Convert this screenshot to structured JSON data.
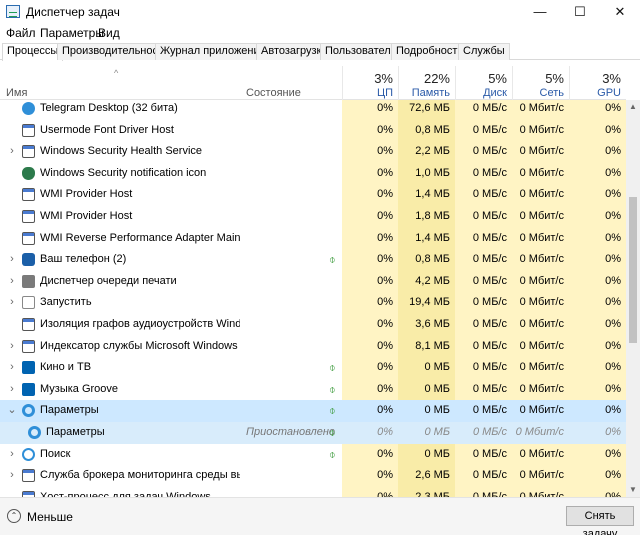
{
  "window": {
    "title": "Диспетчер задач",
    "minimize": "—",
    "maximize": "☐",
    "close": "✕"
  },
  "menu": [
    "Файл",
    "Параметры",
    "Вид"
  ],
  "tabs": [
    "Процессы",
    "Производительность",
    "Журнал приложений",
    "Автозагрузка",
    "Пользователи",
    "Подробности",
    "Службы"
  ],
  "header": {
    "sort_indicator": "^",
    "name": "Имя",
    "status": "Состояние",
    "cpu": {
      "pct": "3%",
      "label": "ЦП"
    },
    "mem": {
      "pct": "22%",
      "label": "Память"
    },
    "disk": {
      "pct": "5%",
      "label": "Диск"
    },
    "net": {
      "pct": "5%",
      "label": "Сеть"
    },
    "gpu": {
      "pct": "3%",
      "label": "GPU"
    }
  },
  "rows": [
    {
      "name": "Telegram Desktop (32 бита)",
      "status": "",
      "cpu": "0%",
      "mem": "72,6 МБ",
      "disk": "0 МБ/с",
      "net": "0 Мбит/с",
      "gpu": "0%",
      "icon": "telegram-icon",
      "expander": "",
      "leaf": ""
    },
    {
      "name": "Usermode Font Driver Host",
      "status": "",
      "cpu": "0%",
      "mem": "0,8 МБ",
      "disk": "0 МБ/с",
      "net": "0 Мбит/с",
      "gpu": "0%",
      "icon": "window-icon",
      "expander": "",
      "leaf": ""
    },
    {
      "name": "Windows Security Health Service",
      "status": "",
      "cpu": "0%",
      "mem": "2,2 МБ",
      "disk": "0 МБ/с",
      "net": "0 Мбит/с",
      "gpu": "0%",
      "icon": "window-icon",
      "expander": "›",
      "leaf": ""
    },
    {
      "name": "Windows Security notification icon",
      "status": "",
      "cpu": "0%",
      "mem": "1,0 МБ",
      "disk": "0 МБ/с",
      "net": "0 Мбит/с",
      "gpu": "0%",
      "icon": "shield-icon",
      "expander": "",
      "leaf": ""
    },
    {
      "name": "WMI Provider Host",
      "status": "",
      "cpu": "0%",
      "mem": "1,4 МБ",
      "disk": "0 МБ/с",
      "net": "0 Мбит/с",
      "gpu": "0%",
      "icon": "window-icon",
      "expander": "",
      "leaf": ""
    },
    {
      "name": "WMI Provider Host",
      "status": "",
      "cpu": "0%",
      "mem": "1,8 МБ",
      "disk": "0 МБ/с",
      "net": "0 Мбит/с",
      "gpu": "0%",
      "icon": "window-icon",
      "expander": "",
      "leaf": ""
    },
    {
      "name": "WMI Reverse Performance Adapter Maintenan...",
      "status": "",
      "cpu": "0%",
      "mem": "1,4 МБ",
      "disk": "0 МБ/с",
      "net": "0 Мбит/с",
      "gpu": "0%",
      "icon": "window-icon",
      "expander": "",
      "leaf": ""
    },
    {
      "name": "Ваш телефон (2)",
      "status": "",
      "cpu": "0%",
      "mem": "0,8 МБ",
      "disk": "0 МБ/с",
      "net": "0 Мбит/с",
      "gpu": "0%",
      "icon": "phone-icon",
      "expander": "›",
      "leaf": "⌽"
    },
    {
      "name": "Диспетчер очереди печати",
      "status": "",
      "cpu": "0%",
      "mem": "4,2 МБ",
      "disk": "0 МБ/с",
      "net": "0 Мбит/с",
      "gpu": "0%",
      "icon": "printer-icon",
      "expander": "›",
      "leaf": ""
    },
    {
      "name": "Запустить",
      "status": "",
      "cpu": "0%",
      "mem": "19,4 МБ",
      "disk": "0 МБ/с",
      "net": "0 Мбит/с",
      "gpu": "0%",
      "icon": "run-icon",
      "expander": "›",
      "leaf": ""
    },
    {
      "name": "Изоляция графов аудиоустройств Windows",
      "status": "",
      "cpu": "0%",
      "mem": "3,6 МБ",
      "disk": "0 МБ/с",
      "net": "0 Мбит/с",
      "gpu": "0%",
      "icon": "window-icon",
      "expander": "",
      "leaf": ""
    },
    {
      "name": "Индексатор службы Microsoft Windows Sear...",
      "status": "",
      "cpu": "0%",
      "mem": "8,1 МБ",
      "disk": "0 МБ/с",
      "net": "0 Мбит/с",
      "gpu": "0%",
      "icon": "search-indexer-icon",
      "expander": "›",
      "leaf": ""
    },
    {
      "name": "Кино и ТВ",
      "status": "",
      "cpu": "0%",
      "mem": "0 МБ",
      "disk": "0 МБ/с",
      "net": "0 Мбит/с",
      "gpu": "0%",
      "icon": "play-icon",
      "expander": "›",
      "leaf": "⌽"
    },
    {
      "name": "Музыка Groove",
      "status": "",
      "cpu": "0%",
      "mem": "0 МБ",
      "disk": "0 МБ/с",
      "net": "0 Мбит/с",
      "gpu": "0%",
      "icon": "groove-icon",
      "expander": "›",
      "leaf": "⌽"
    },
    {
      "name": "Параметры",
      "status": "",
      "cpu": "0%",
      "mem": "0 МБ",
      "disk": "0 МБ/с",
      "net": "0 Мбит/с",
      "gpu": "0%",
      "icon": "gear-icon",
      "expander": "⌄",
      "leaf": "⌽",
      "kind": "selected"
    },
    {
      "name": "Параметры",
      "status": "Приостановлено",
      "cpu": "0%",
      "mem": "0 МБ",
      "disk": "0 МБ/с",
      "net": "0 Мбит/с",
      "gpu": "0%",
      "icon": "gear-icon",
      "expander": "",
      "leaf": "⌽",
      "kind": "child"
    },
    {
      "name": "Поиск",
      "status": "",
      "cpu": "0%",
      "mem": "0 МБ",
      "disk": "0 МБ/с",
      "net": "0 Мбит/с",
      "gpu": "0%",
      "icon": "search-icon",
      "expander": "›",
      "leaf": "⌽"
    },
    {
      "name": "Служба брокера мониторинга среды выпол...",
      "status": "",
      "cpu": "0%",
      "mem": "2,6 МБ",
      "disk": "0 МБ/с",
      "net": "0 Мбит/с",
      "gpu": "0%",
      "icon": "window-icon",
      "expander": "›",
      "leaf": ""
    },
    {
      "name": "Хост-процесс для задач Windows",
      "status": "",
      "cpu": "0%",
      "mem": "2,3 МБ",
      "disk": "0 МБ/с",
      "net": "0 Мбит/с",
      "gpu": "0%",
      "icon": "window-icon",
      "expander": "",
      "leaf": ""
    }
  ],
  "scrollbar": {
    "up": "▲",
    "down": "▼"
  },
  "footer": {
    "fewer_glyph": "⌃",
    "fewer_label": "Меньше",
    "end_task": "Снять задачу"
  }
}
